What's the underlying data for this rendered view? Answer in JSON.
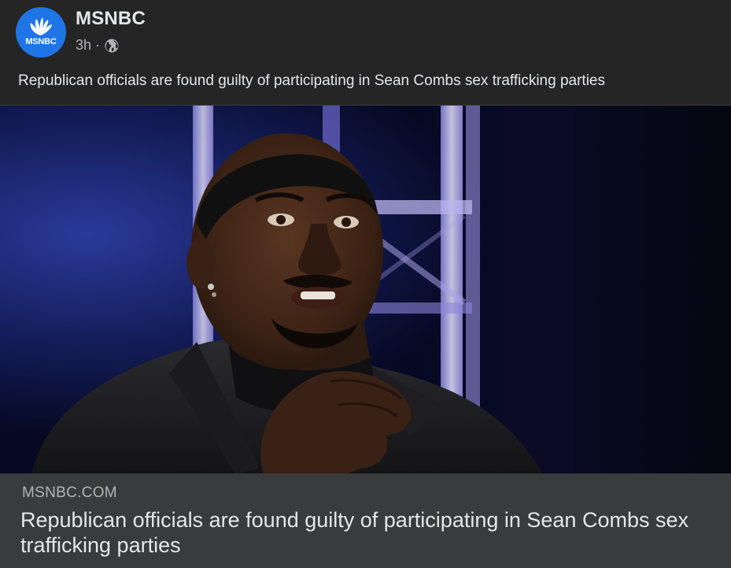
{
  "post": {
    "page_name": "MSNBC",
    "timestamp": "3h",
    "separator": "·",
    "audience_icon": "globe-icon",
    "caption": "Republican officials are found guilty of participating in Sean Combs sex trafficking parties"
  },
  "avatar": {
    "logo_text": "MSNBC",
    "logo_icon": "peacock-icon",
    "background_color": "#1f74e6"
  },
  "link_preview": {
    "domain": "MSNBC.COM",
    "title": "Republican officials are found guilty of participating in Sean Combs sex trafficking parties"
  },
  "colors": {
    "background": "#252526",
    "link_box": "#3a3b3c",
    "primary_text": "#e4e6eb",
    "secondary_text": "#b0b3b8"
  }
}
